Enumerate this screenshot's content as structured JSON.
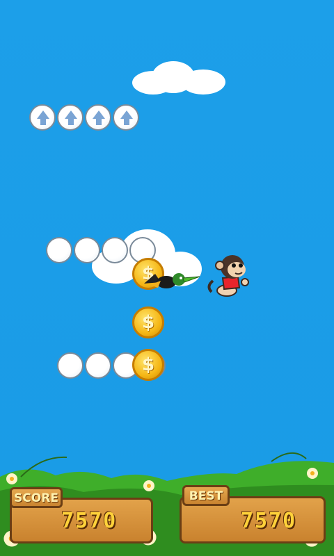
{
  "hud": {
    "score_label": "SCORE",
    "score_value": "7570",
    "best_label": "BEST",
    "best_value": "7570"
  },
  "coins": {
    "symbol": "$"
  },
  "colors": {
    "sky": "#1a9ee8",
    "coin": "#f5b716",
    "wood": "#c9822e",
    "grass": "#3fae2a"
  }
}
